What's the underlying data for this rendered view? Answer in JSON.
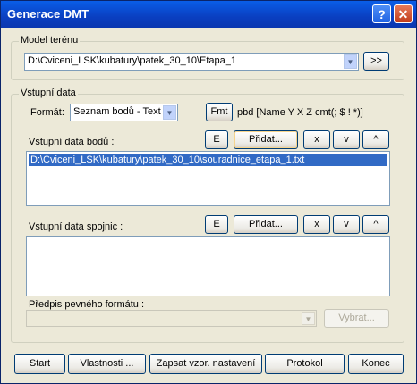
{
  "window": {
    "title": "Generace DMT",
    "help_label": "?",
    "close_label": "✕"
  },
  "model": {
    "group_label": "Model terénu",
    "path": "D:\\Cviceni_LSK\\kubatury\\patek_30_10\\Etapa_1",
    "browse_label": ">>"
  },
  "input": {
    "group_label": "Vstupní data",
    "format_label": "Formát:",
    "format_value": "Seznam bodů - Text",
    "fmt_button": "Fmt",
    "format_description": "pbd [Name Y X Z cmt(; $ ! *)]",
    "points": {
      "label": "Vstupní data bodů :",
      "e": "E",
      "add": "Přidat...",
      "x": "x",
      "down": "v",
      "up": "^",
      "items": [
        "D:\\Cviceni_LSK\\kubatury\\patek_30_10\\souradnice_etapa_1.txt"
      ]
    },
    "lines": {
      "label": "Vstupní data spojnic :",
      "e": "E",
      "add": "Přidat...",
      "x": "x",
      "down": "v",
      "up": "^"
    },
    "fixed_format": {
      "label": "Předpis pevného formátu :",
      "value": "",
      "select_label": "Vybrat..."
    }
  },
  "footer": {
    "start": "Start",
    "properties": "Vlastnosti ...",
    "save_defaults": "Zapsat vzor. nastavení",
    "protocol": "Protokol",
    "end": "Konec"
  },
  "icons": {
    "dropdown": "chevron-down-icon"
  }
}
